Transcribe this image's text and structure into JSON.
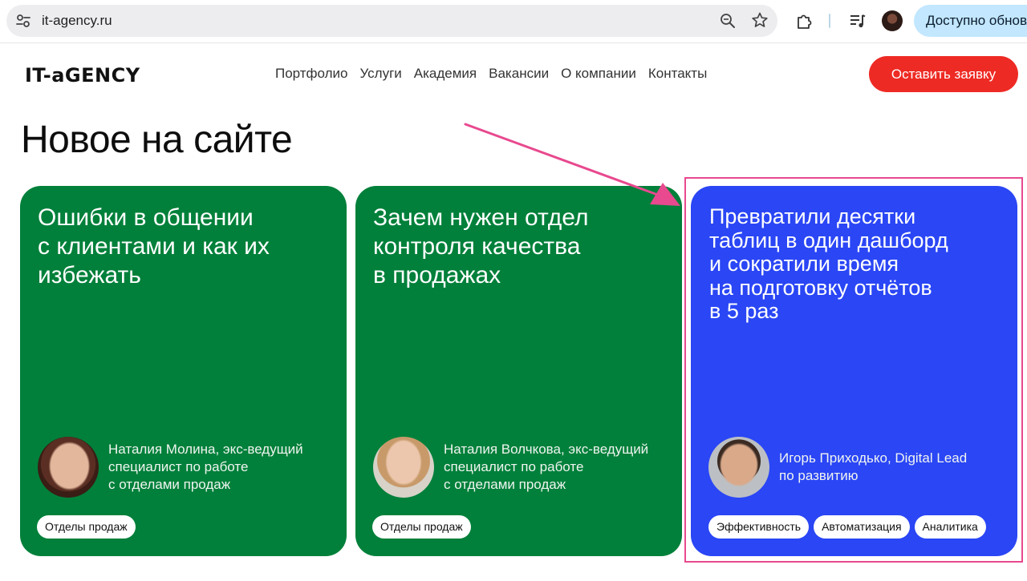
{
  "browser": {
    "url": "it-agency.ru",
    "update_label": "Доступно обновление",
    "icons": [
      "tune-icon",
      "zoom-icon",
      "star-icon",
      "extensions-icon",
      "media-icon"
    ],
    "update_color": "#c2e7ff"
  },
  "header": {
    "logo": "IT-aGENCY",
    "nav": [
      "Портфолио",
      "Услуги",
      "Академия",
      "Вакансии",
      "О компании",
      "Контакты"
    ],
    "cta_label": "Оставить заявку",
    "cta_color": "#ee2a24"
  },
  "main": {
    "title": "Новое на сайте",
    "cards": [
      {
        "title": "Ошибки в общении\nс клиентами и как их\nизбежать",
        "author": "Наталия Молина, экс-ведущий\nспециалист по работе\nс отделами продаж",
        "tags": [
          "Отделы продаж"
        ],
        "color": "#00803a"
      },
      {
        "title": "Зачем нужен отдел\nконтроля качества\nв продажах",
        "author": "Наталия Волчкова, экс-ведущий\nспециалист по работе\nс отделами продаж",
        "tags": [
          "Отделы продаж"
        ],
        "color": "#00803a"
      },
      {
        "title": "Превратили десятки\nтаблиц в один дашборд\nи сократили время\nна подготовку отчётов\nв 5 раз",
        "author": "Игорь Приходько, Digital Lead\nпо развитию",
        "tags": [
          "Эффективность",
          "Автоматизация",
          "Аналитика"
        ],
        "color": "#2a46f5"
      }
    ],
    "annotation_color": "#e8498f"
  }
}
